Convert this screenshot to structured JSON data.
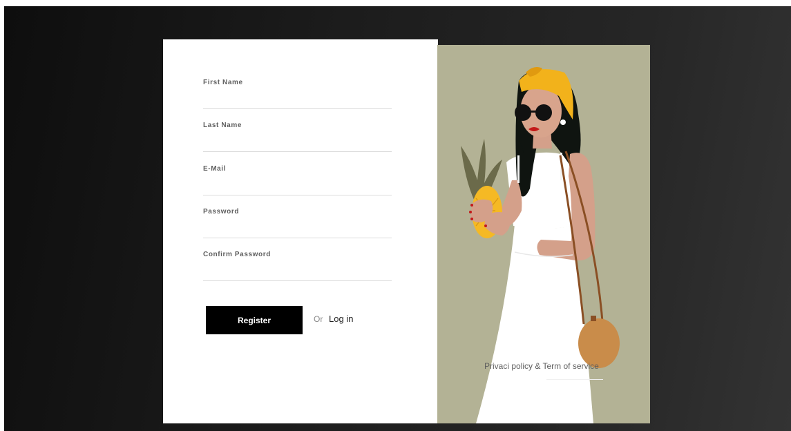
{
  "form": {
    "fields": [
      {
        "label": "First Name",
        "value": ""
      },
      {
        "label": "Last Name",
        "value": ""
      },
      {
        "label": "E-Mail",
        "value": ""
      },
      {
        "label": "Password",
        "value": ""
      },
      {
        "label": "Confirm Password",
        "value": ""
      }
    ],
    "register_label": "Register",
    "or_text": "Or",
    "login_label": "Log in"
  },
  "illustration": {
    "policy_label": "Privaci policy & Term of service"
  },
  "colors": {
    "background": "#1a1a1a",
    "card": "#ffffff",
    "button": "#000000",
    "illustration_bg": "#b3b295",
    "headband": "#f2b21b"
  }
}
